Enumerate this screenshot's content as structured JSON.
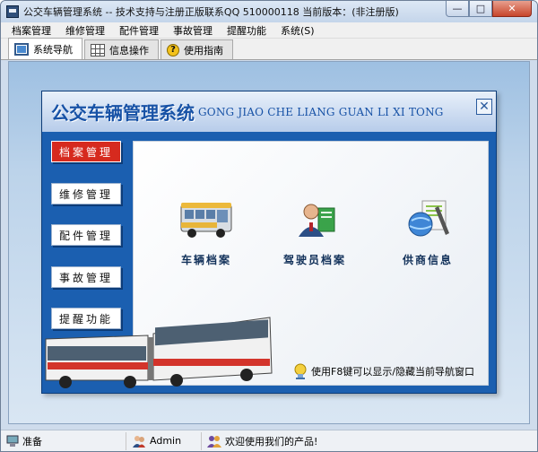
{
  "window": {
    "title": "公交车辆管理系统 -- 技术支持与注册正版联系QQ 510000118   当前版本：(非注册版)",
    "controls": {
      "minimize": "—",
      "maximize": "□",
      "close": "✕"
    }
  },
  "menu": [
    "档案管理",
    "维修管理",
    "配件管理",
    "事故管理",
    "提醒功能",
    "系统(S)"
  ],
  "tabs": [
    {
      "label": "系统导航",
      "icon": "monitor-icon",
      "active": true
    },
    {
      "label": "信息操作",
      "icon": "grid-icon",
      "active": false
    },
    {
      "label": "使用指南",
      "icon": "help-icon",
      "active": false
    }
  ],
  "panel": {
    "title": "公交车辆管理系统",
    "subtitle": "GONG JIAO CHE LIANG GUAN LI XI TONG",
    "close": "✕",
    "nav": [
      "档案管理",
      "维修管理",
      "配件管理",
      "事故管理",
      "提醒功能"
    ],
    "features": [
      {
        "label": "车辆档案",
        "icon": "bus-icon"
      },
      {
        "label": "驾驶员档案",
        "icon": "driver-icon"
      },
      {
        "label": "供商信息",
        "icon": "supplier-icon"
      }
    ],
    "hint": "使用F8键可以显示/隐藏当前导航窗口"
  },
  "status": {
    "ready": "准备",
    "user": "Admin",
    "welcome": "欢迎使用我们的产品!"
  },
  "colors": {
    "panel_blue": "#1b5fb0",
    "active_nav": "#d62a1e",
    "title_blue": "#1752a6"
  }
}
